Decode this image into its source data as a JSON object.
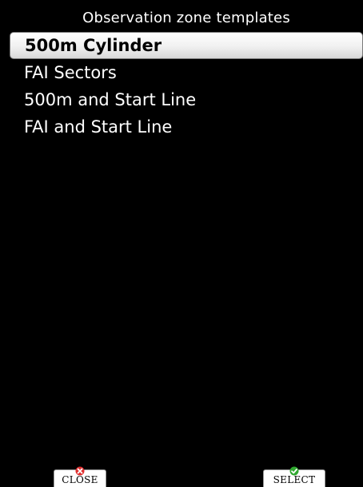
{
  "header": {
    "title": "Observation zone templates"
  },
  "list": {
    "items": [
      {
        "label": "500m Cylinder",
        "selected": true
      },
      {
        "label": "FAI Sectors",
        "selected": false
      },
      {
        "label": "500m and Start Line",
        "selected": false
      },
      {
        "label": "FAI and Start Line",
        "selected": false
      }
    ]
  },
  "buttons": {
    "close": {
      "label": "CLOSE",
      "icon": "close-x-icon",
      "icon_color": "#e03030"
    },
    "select": {
      "label": "SELECT",
      "icon": "checkmark-icon",
      "icon_color": "#2fa82f"
    }
  },
  "colors": {
    "background": "#000000",
    "text": "#ffffff",
    "selected_text": "#000000"
  }
}
